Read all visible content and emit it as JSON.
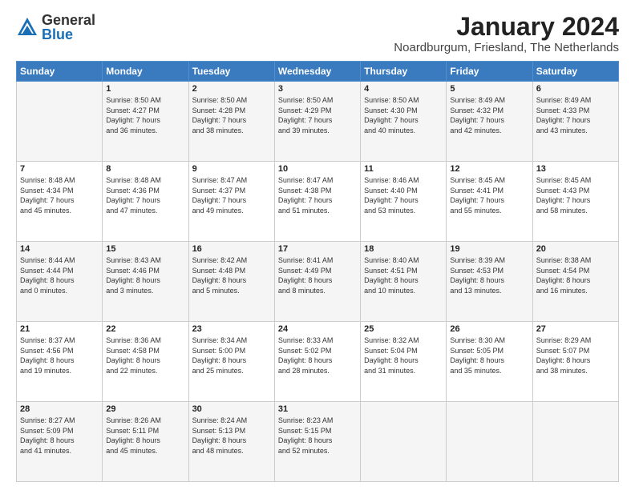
{
  "logo": {
    "general": "General",
    "blue": "Blue"
  },
  "header": {
    "month": "January 2024",
    "location": "Noardburgum, Friesland, The Netherlands"
  },
  "days_of_week": [
    "Sunday",
    "Monday",
    "Tuesday",
    "Wednesday",
    "Thursday",
    "Friday",
    "Saturday"
  ],
  "weeks": [
    [
      {
        "num": "",
        "info": ""
      },
      {
        "num": "1",
        "info": "Sunrise: 8:50 AM\nSunset: 4:27 PM\nDaylight: 7 hours\nand 36 minutes."
      },
      {
        "num": "2",
        "info": "Sunrise: 8:50 AM\nSunset: 4:28 PM\nDaylight: 7 hours\nand 38 minutes."
      },
      {
        "num": "3",
        "info": "Sunrise: 8:50 AM\nSunset: 4:29 PM\nDaylight: 7 hours\nand 39 minutes."
      },
      {
        "num": "4",
        "info": "Sunrise: 8:50 AM\nSunset: 4:30 PM\nDaylight: 7 hours\nand 40 minutes."
      },
      {
        "num": "5",
        "info": "Sunrise: 8:49 AM\nSunset: 4:32 PM\nDaylight: 7 hours\nand 42 minutes."
      },
      {
        "num": "6",
        "info": "Sunrise: 8:49 AM\nSunset: 4:33 PM\nDaylight: 7 hours\nand 43 minutes."
      }
    ],
    [
      {
        "num": "7",
        "info": "Sunrise: 8:48 AM\nSunset: 4:34 PM\nDaylight: 7 hours\nand 45 minutes."
      },
      {
        "num": "8",
        "info": "Sunrise: 8:48 AM\nSunset: 4:36 PM\nDaylight: 7 hours\nand 47 minutes."
      },
      {
        "num": "9",
        "info": "Sunrise: 8:47 AM\nSunset: 4:37 PM\nDaylight: 7 hours\nand 49 minutes."
      },
      {
        "num": "10",
        "info": "Sunrise: 8:47 AM\nSunset: 4:38 PM\nDaylight: 7 hours\nand 51 minutes."
      },
      {
        "num": "11",
        "info": "Sunrise: 8:46 AM\nSunset: 4:40 PM\nDaylight: 7 hours\nand 53 minutes."
      },
      {
        "num": "12",
        "info": "Sunrise: 8:45 AM\nSunset: 4:41 PM\nDaylight: 7 hours\nand 55 minutes."
      },
      {
        "num": "13",
        "info": "Sunrise: 8:45 AM\nSunset: 4:43 PM\nDaylight: 7 hours\nand 58 minutes."
      }
    ],
    [
      {
        "num": "14",
        "info": "Sunrise: 8:44 AM\nSunset: 4:44 PM\nDaylight: 8 hours\nand 0 minutes."
      },
      {
        "num": "15",
        "info": "Sunrise: 8:43 AM\nSunset: 4:46 PM\nDaylight: 8 hours\nand 3 minutes."
      },
      {
        "num": "16",
        "info": "Sunrise: 8:42 AM\nSunset: 4:48 PM\nDaylight: 8 hours\nand 5 minutes."
      },
      {
        "num": "17",
        "info": "Sunrise: 8:41 AM\nSunset: 4:49 PM\nDaylight: 8 hours\nand 8 minutes."
      },
      {
        "num": "18",
        "info": "Sunrise: 8:40 AM\nSunset: 4:51 PM\nDaylight: 8 hours\nand 10 minutes."
      },
      {
        "num": "19",
        "info": "Sunrise: 8:39 AM\nSunset: 4:53 PM\nDaylight: 8 hours\nand 13 minutes."
      },
      {
        "num": "20",
        "info": "Sunrise: 8:38 AM\nSunset: 4:54 PM\nDaylight: 8 hours\nand 16 minutes."
      }
    ],
    [
      {
        "num": "21",
        "info": "Sunrise: 8:37 AM\nSunset: 4:56 PM\nDaylight: 8 hours\nand 19 minutes."
      },
      {
        "num": "22",
        "info": "Sunrise: 8:36 AM\nSunset: 4:58 PM\nDaylight: 8 hours\nand 22 minutes."
      },
      {
        "num": "23",
        "info": "Sunrise: 8:34 AM\nSunset: 5:00 PM\nDaylight: 8 hours\nand 25 minutes."
      },
      {
        "num": "24",
        "info": "Sunrise: 8:33 AM\nSunset: 5:02 PM\nDaylight: 8 hours\nand 28 minutes."
      },
      {
        "num": "25",
        "info": "Sunrise: 8:32 AM\nSunset: 5:04 PM\nDaylight: 8 hours\nand 31 minutes."
      },
      {
        "num": "26",
        "info": "Sunrise: 8:30 AM\nSunset: 5:05 PM\nDaylight: 8 hours\nand 35 minutes."
      },
      {
        "num": "27",
        "info": "Sunrise: 8:29 AM\nSunset: 5:07 PM\nDaylight: 8 hours\nand 38 minutes."
      }
    ],
    [
      {
        "num": "28",
        "info": "Sunrise: 8:27 AM\nSunset: 5:09 PM\nDaylight: 8 hours\nand 41 minutes."
      },
      {
        "num": "29",
        "info": "Sunrise: 8:26 AM\nSunset: 5:11 PM\nDaylight: 8 hours\nand 45 minutes."
      },
      {
        "num": "30",
        "info": "Sunrise: 8:24 AM\nSunset: 5:13 PM\nDaylight: 8 hours\nand 48 minutes."
      },
      {
        "num": "31",
        "info": "Sunrise: 8:23 AM\nSunset: 5:15 PM\nDaylight: 8 hours\nand 52 minutes."
      },
      {
        "num": "",
        "info": ""
      },
      {
        "num": "",
        "info": ""
      },
      {
        "num": "",
        "info": ""
      }
    ]
  ]
}
